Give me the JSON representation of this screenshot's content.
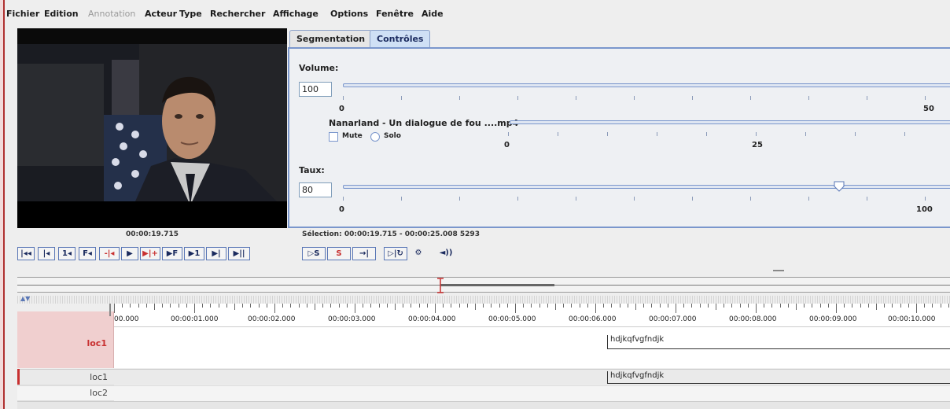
{
  "menu": [
    "Fichier",
    "Edition",
    "Annotation",
    "Acteur",
    "Type",
    "Rechercher",
    "Affichage",
    "Options",
    "Fenêtre",
    "Aide"
  ],
  "player": {
    "timecode": "00:00:19.715",
    "buttons": [
      "|◂◂",
      "|◂",
      "1◂",
      "F◂",
      "-|◂",
      "▶",
      "▶|+",
      "▶F",
      "▶1",
      "▶|",
      "▶||"
    ]
  },
  "tabs": {
    "segmentation": "Segmentation",
    "controles": "Contrôles"
  },
  "controls": {
    "volume_label": "Volume:",
    "volume_value": "100",
    "volume_scale_min": "0",
    "volume_scale_mid": "50",
    "media_name": "Nanarland - Un dialogue de fou ....mp4",
    "mute_label": "Mute",
    "solo_label": "Solo",
    "media_scale_min": "0",
    "media_scale_mid": "25",
    "rate_label": "Taux:",
    "rate_value": "80",
    "rate_scale_min": "0",
    "rate_scale_max": "100",
    "rate_level": 0.8
  },
  "selection": "Sélection: 00:00:19.715 - 00:00:25.008  5293",
  "selection_buttons": [
    "▷S",
    "S",
    "→|",
    "▷|↻",
    "⚙",
    "◄))"
  ],
  "ruler": [
    "00.000",
    "00:00:01.000",
    "00:00:02.000",
    "00:00:03.000",
    "00:00:04.000",
    "00:00:05.000",
    "00:00:06.000",
    "00:00:07.000",
    "00:00:08.000",
    "00:00:09.000",
    "00:00:10.000"
  ],
  "tiers": {
    "main": "loc1",
    "row1": "loc1",
    "row2": "loc2"
  },
  "annotation": "hdjkqfvgfndjk",
  "colors": {
    "accent": "#5a77b6",
    "tier_selected": "#f0cfcf",
    "cursor": "#c83030"
  }
}
